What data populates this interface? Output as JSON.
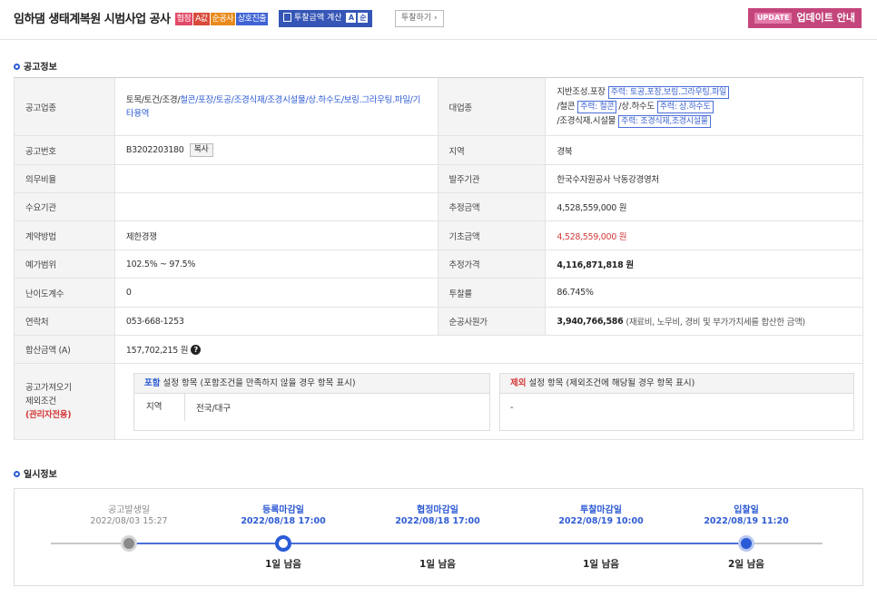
{
  "header": {
    "title": "임하댐 생태계복원 시범사업 공사",
    "tags": [
      "협정",
      "A값",
      "순공사",
      "상호진출"
    ],
    "calc_label": "투찰금액 계산",
    "calc_a": "A",
    "calc_b": "순",
    "bid_label": "투찰하기 ›",
    "update_badge": "UPDATE",
    "update_label": "업데이트 안내"
  },
  "sections": {
    "notice": "공고정보",
    "schedule": "일시정보"
  },
  "info": {
    "industry_label": "공고업종",
    "industry_plain": "토목/토건/조경/",
    "industry_link": "철콘/포장/토공/조경식재/조경시설물/상.하수도/보링.그라우팅.파일/기타용역",
    "major_label": "대업종",
    "major_lines": [
      {
        "text": "지반조성.포장",
        "chip": "주력: 토공,포장,보링.그라우팅.파일"
      },
      {
        "text": "/철콘",
        "chip": "주력: 철콘",
        "text2": "/상.하수도",
        "chip2": "주력: 상.하수도"
      },
      {
        "text": "/조경식재.시설물",
        "chip": "주력: 조경식재,조경시설물"
      }
    ],
    "notice_no_label": "공고번호",
    "notice_no": "B3202203180",
    "copy_label": "복사",
    "region_label": "지역",
    "region": "경북",
    "duty_label": "의무비율",
    "duty": "",
    "client_label": "발주기관",
    "client": "한국수자원공사 낙동강경영처",
    "demand_label": "수요기관",
    "demand": "",
    "est_amount_label": "추정금액",
    "est_amount": "4,528,559,000 원",
    "contract_label": "계약방법",
    "contract": "제한경쟁",
    "base_amount_label": "기초금액",
    "base_amount": "4,528,559,000 원",
    "range_label": "예가범위",
    "range": "102.5% ~ 97.5%",
    "est_price_label": "추정가격",
    "est_price": "4,116,871,818 원",
    "difficulty_label": "난이도계수",
    "difficulty": "0",
    "rate_label": "투찰률",
    "rate": "86.745%",
    "contact_label": "연락처",
    "contact": "053-668-1253",
    "net_cost_label": "순공사원가",
    "net_cost": "3,940,766,586",
    "net_cost_note": "(재료비, 노무비, 경비 및 부가가치세를 합산한 금액)",
    "sum_label": "합산금액 (A)",
    "sum": "157,702,215 원",
    "exclude_label_1": "공고가져오기",
    "exclude_label_2": "제외조건",
    "exclude_label_3": "(관리자전용)",
    "include_head_word": "포함",
    "include_head_rest": " 설정 항목 (포함조건을 만족하지 않을 경우 항목 표시)",
    "include_key": "지역",
    "include_val": "전국/대구",
    "exclude_head_word": "제외",
    "exclude_head_rest": " 설정 항목 (제외조건에 해당될 경우 항목 표시)",
    "exclude_val": "-"
  },
  "timeline": [
    {
      "label": "공고발생일",
      "date": "2022/08/03 15:27",
      "remain": ""
    },
    {
      "label": "등록마감일",
      "date": "2022/08/18 17:00",
      "remain": "1일 남음"
    },
    {
      "label": "협정마감일",
      "date": "2022/08/18 17:00",
      "remain": "1일 남음"
    },
    {
      "label": "투찰마감일",
      "date": "2022/08/19 10:00",
      "remain": "1일 남음"
    },
    {
      "label": "입찰일",
      "date": "2022/08/19 11:20",
      "remain": "2일 남음"
    }
  ]
}
